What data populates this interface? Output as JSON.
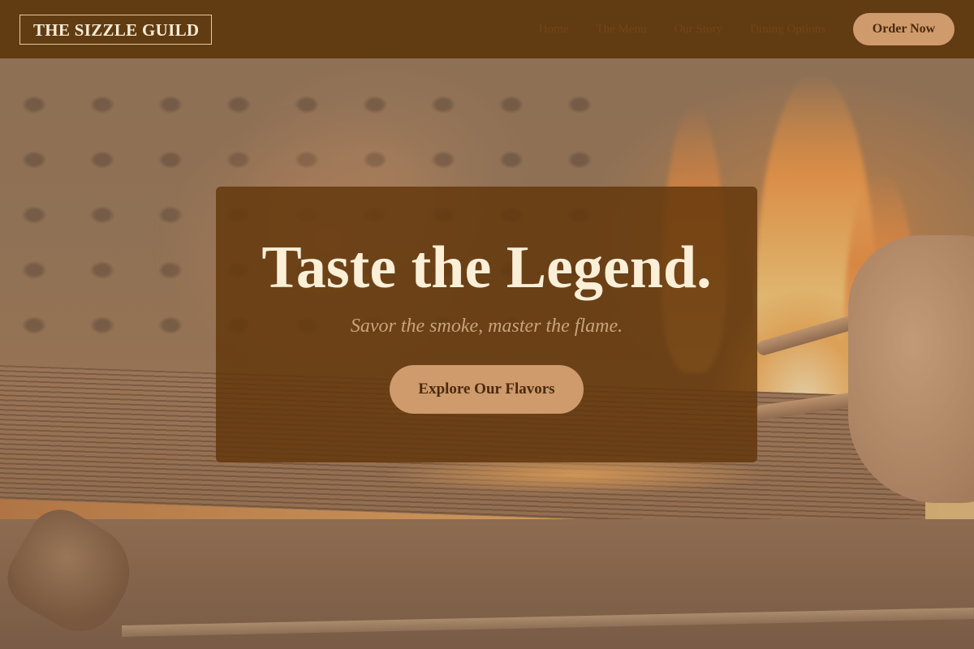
{
  "brand": {
    "name": "THE SIZZLE GUILD"
  },
  "nav": {
    "items": [
      {
        "label": "Home"
      },
      {
        "label": "The Menu"
      },
      {
        "label": "Our Story"
      },
      {
        "label": "Dining Options"
      }
    ],
    "order_label": "Order Now"
  },
  "hero": {
    "title": "Taste the Legend.",
    "subtitle": "Savor the smoke, master the flame.",
    "cta_label": "Explore Our Flavors"
  },
  "colors": {
    "header_bg": "#603a10",
    "accent": "#cf9b6c",
    "card_bg": "#62360a",
    "title_text": "#fbefd8",
    "subtitle_text": "#c9a47a"
  }
}
